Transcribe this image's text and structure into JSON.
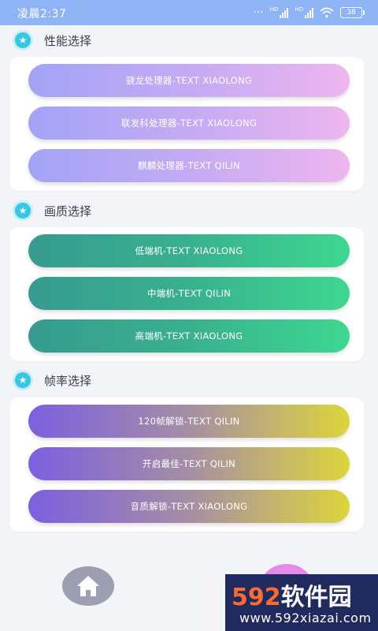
{
  "status_bar": {
    "time": "凌晨2:37",
    "battery": "38",
    "hd_label": "HD"
  },
  "sections": [
    {
      "title": "性能选择",
      "buttons": [
        "骁龙处理器-TEXT XIAOLONG",
        "联发科处理器-TEXT XIAOLONG",
        "麒麟处理器-TEXT QILIN"
      ]
    },
    {
      "title": "画质选择",
      "buttons": [
        "低端机-TEXT XIAOLONG",
        "中端机-TEXT QILIN",
        "高端机-TEXT XIAOLONG"
      ]
    },
    {
      "title": "帧率选择",
      "buttons": [
        "120帧解锁-TEXT QILIN",
        "开启最佳-TEXT QILIN",
        "音质解锁-TEXT XIAOLONG"
      ]
    }
  ],
  "watermark": {
    "brand_num": "592",
    "brand_text": "软件园",
    "url": "www.592xiazai.com"
  },
  "colors": {
    "status_bar": "#8fb4f6",
    "accent_star": "#36c7e3",
    "purple_start": "#a2a3f6",
    "purple_end": "#eeb6ee",
    "green_start": "#379b8f",
    "green_end": "#3ed791",
    "fps_start": "#7c5fe0",
    "fps_end": "#dcd63a"
  },
  "icons": {
    "section": "star-icon",
    "nav_home": "home-icon"
  }
}
